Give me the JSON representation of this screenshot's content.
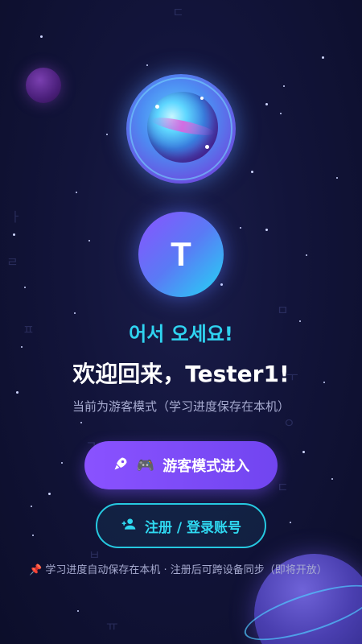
{
  "logo": {
    "icon": "planet-logo"
  },
  "avatar": {
    "initial": "T"
  },
  "greeting": {
    "korean": "어서 오세요!",
    "welcome": "欢迎回来，Tester1!",
    "mode_note": "当前为游客模式（学习进度保存在本机）"
  },
  "buttons": {
    "guest_icon": "rocket-icon",
    "guest_emoji": "🎮",
    "guest_label": "游客模式进入",
    "register_icon": "add-user-icon",
    "register_label": "注册 / 登录账号"
  },
  "footer": {
    "pin": "📌",
    "note": "学习进度自动保存在本机 · 注册后可跨设备同步（即将开放）"
  },
  "colors": {
    "accent_cyan": "#2fd3f0",
    "accent_purple": "#8a52ff",
    "background": "#12143a"
  }
}
